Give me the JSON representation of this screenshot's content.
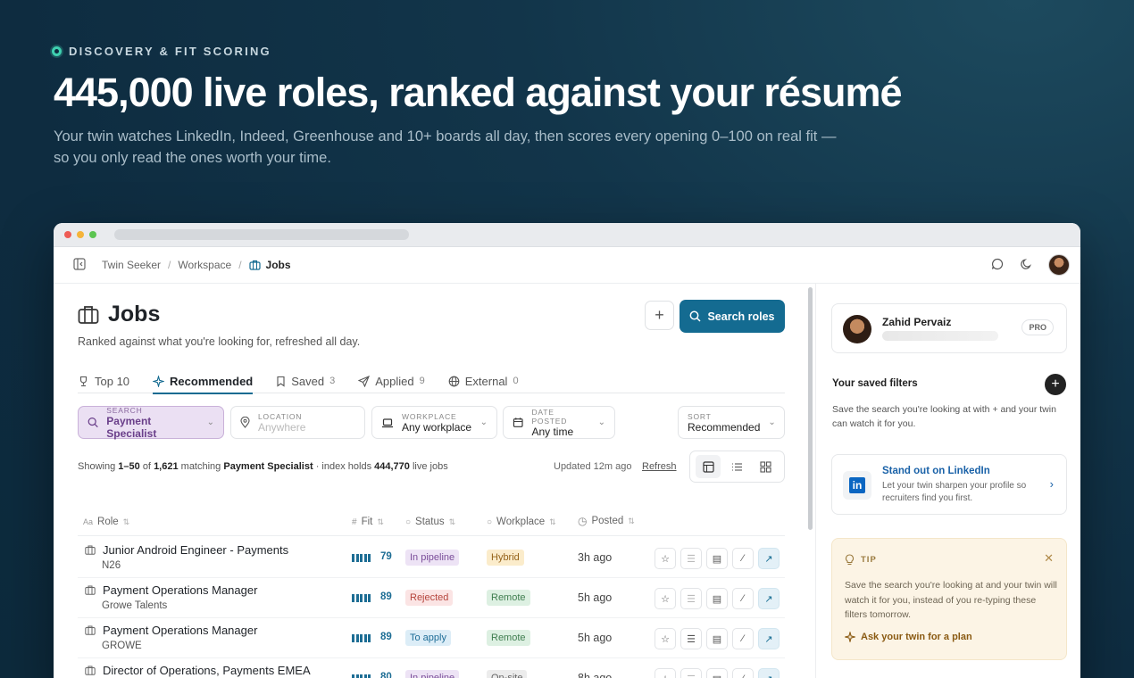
{
  "hero": {
    "eyebrow": "DISCOVERY & FIT SCORING",
    "headline": "445,000 live roles, ranked against your résumé",
    "subtitle": "Your twin watches LinkedIn, Indeed, Greenhouse and 10+ boards all day, then scores every opening 0–100 on real fit — so you only read the ones worth your time."
  },
  "breadcrumb": [
    "Twin Seeker",
    "Workspace",
    "Jobs"
  ],
  "page": {
    "title": "Jobs",
    "subtitle": "Ranked against what you're looking for, refreshed all day.",
    "add_label": "+",
    "search_label": "Search roles"
  },
  "tabs": [
    {
      "label": "Top 10",
      "count": "",
      "icon": "trophy-icon"
    },
    {
      "label": "Recommended",
      "count": "",
      "icon": "sparkle-icon",
      "active": true
    },
    {
      "label": "Saved",
      "count": "3",
      "icon": "bookmark-icon"
    },
    {
      "label": "Applied",
      "count": "9",
      "icon": "send-icon"
    },
    {
      "label": "External",
      "count": "0",
      "icon": "globe-icon"
    }
  ],
  "filters": {
    "search": {
      "key": "SEARCH",
      "value": "Payment Specialist"
    },
    "location": {
      "key": "LOCATION",
      "value": "Anywhere"
    },
    "workplace": {
      "key": "WORKPLACE",
      "value": "Any workplace"
    },
    "date_posted": {
      "key": "DATE POSTED",
      "value": "Any time"
    },
    "sort": {
      "key": "SORT",
      "value": "Recommended"
    }
  },
  "results": {
    "prefix": "Showing",
    "range": "1–50",
    "of": "of",
    "total": "1,621",
    "matching": "matching",
    "query": "Payment Specialist",
    "index_text": "· index holds",
    "index_total": "444,770",
    "live_jobs": "live jobs",
    "updated": "Updated 12m ago",
    "refresh": "Refresh"
  },
  "columns": {
    "role": "Role",
    "fit": "Fit",
    "status": "Status",
    "workplace": "Workplace",
    "posted": "Posted",
    "role_prefix": "Aa",
    "fit_prefix": "#"
  },
  "rows": [
    {
      "role": "Junior Android Engineer - Payments",
      "company": "N26",
      "fit": "79",
      "status": "In pipeline",
      "workplace": "Hybrid",
      "posted": "3h ago"
    },
    {
      "role": "Payment Operations Manager",
      "company": "Growe Talents",
      "fit": "89",
      "status": "Rejected",
      "workplace": "Remote",
      "posted": "5h ago"
    },
    {
      "role": "Payment Operations Manager",
      "company": "GROWE",
      "fit": "89",
      "status": "To apply",
      "workplace": "Remote",
      "posted": "5h ago"
    },
    {
      "role": "Director of Operations, Payments EMEA",
      "company": "",
      "fit": "80",
      "status": "In pipeline",
      "workplace": "On-site",
      "posted": "8h ago"
    }
  ],
  "colors": {
    "accent": "#146b91",
    "in_pipeline_bg": "#ede3f5",
    "in_pipeline_fg": "#7a4d99",
    "rejected_bg": "#fbe4e4",
    "rejected_fg": "#b5443c",
    "to_apply_bg": "#dcedf7",
    "to_apply_fg": "#1e6d97",
    "hybrid_bg": "#fbeccb",
    "hybrid_fg": "#95631a",
    "remote_bg": "#ddf0e2",
    "remote_fg": "#3f7d4f",
    "onsite_bg": "#ececec",
    "onsite_fg": "#666666"
  },
  "side": {
    "profile_name": "Zahid Pervaiz",
    "plan": "PRO",
    "saved_filters_title": "Your saved filters",
    "saved_filters_desc": "Save the search you're looking at with + and your twin can watch it for you.",
    "linkedin_title": "Stand out on LinkedIn",
    "linkedin_desc": "Let your twin sharpen your profile so recruiters find you first.",
    "tip_label": "TIP",
    "tip_body": "Save the search you're looking at and your twin will watch it for you, instead of you re-typing these filters tomorrow.",
    "tip_cta": "Ask your twin for a plan"
  }
}
